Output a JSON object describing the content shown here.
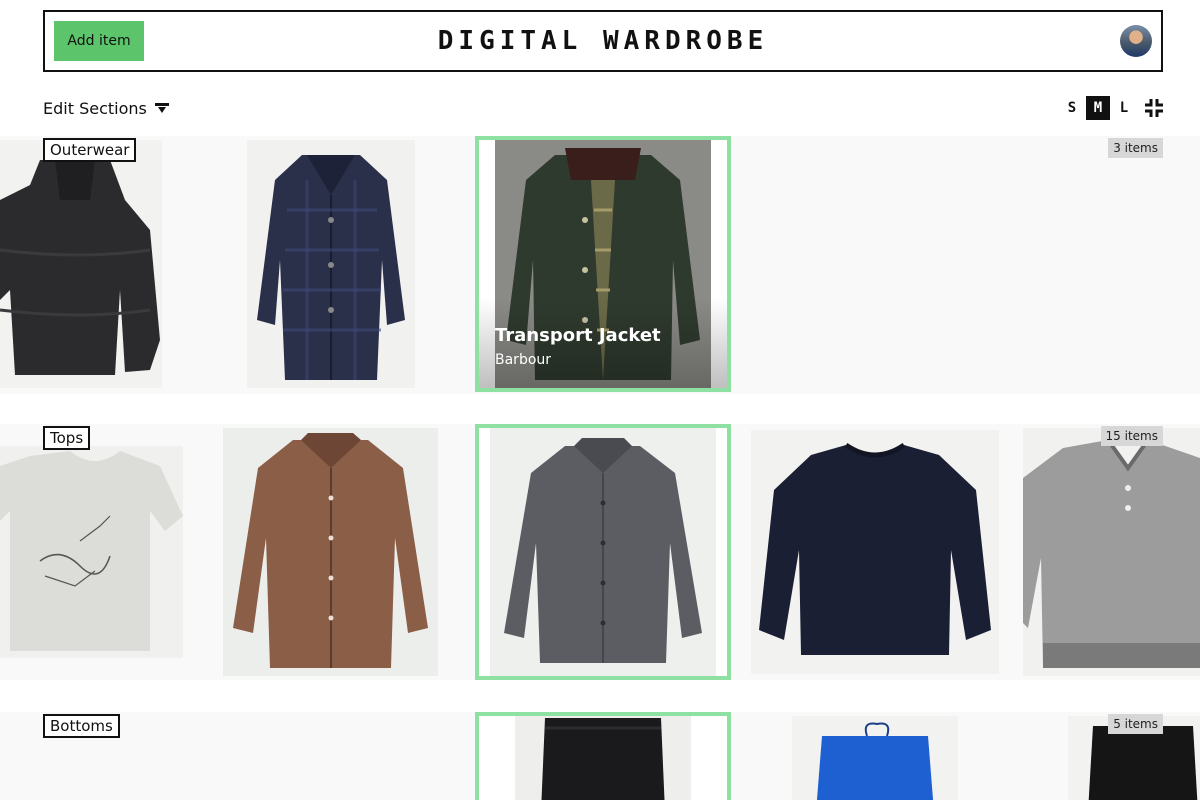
{
  "header": {
    "add_button_label": "Add item",
    "title": "DIGITAL WARDROBE"
  },
  "toolbar": {
    "edit_sections_label": "Edit Sections",
    "sizes": [
      "S",
      "M",
      "L"
    ],
    "active_size": "M"
  },
  "sections": [
    {
      "label": "Outerwear",
      "count": "3 items",
      "items": [
        {
          "garment": "puffer-jacket",
          "color": "#2b2b2d"
        },
        {
          "garment": "plaid-coat",
          "color": "#2a2f4a"
        },
        {
          "garment": "waxed-jacket",
          "color": "#2f3a2e",
          "name": "Transport Jacket",
          "brand": "Barbour",
          "selected": true
        }
      ]
    },
    {
      "label": "Tops",
      "count": "15 items",
      "items": [
        {
          "garment": "graphic-tee",
          "color": "#dcdcd8"
        },
        {
          "garment": "check-shirt",
          "color": "#8b5e48"
        },
        {
          "garment": "flannel-shirt",
          "color": "#5c5d63",
          "selected": true
        },
        {
          "garment": "crewneck-sweatshirt",
          "color": "#1b1f33"
        },
        {
          "garment": "houndstooth-polo",
          "color": "#9c9c9c"
        }
      ]
    },
    {
      "label": "Bottoms",
      "count": "5 items",
      "items": [
        {
          "garment": "black-jeans",
          "color": "#1a1a1c",
          "selected": true
        },
        {
          "garment": "blue-sweatpants",
          "color": "#1e5fd1"
        },
        {
          "garment": "black-cords",
          "color": "#151515"
        }
      ]
    }
  ],
  "colors": {
    "accent_green": "#5cc46a",
    "selected_border": "#8fe0a3",
    "section_background": "#f9f9f9",
    "badge_background": "#d7d7d7"
  }
}
